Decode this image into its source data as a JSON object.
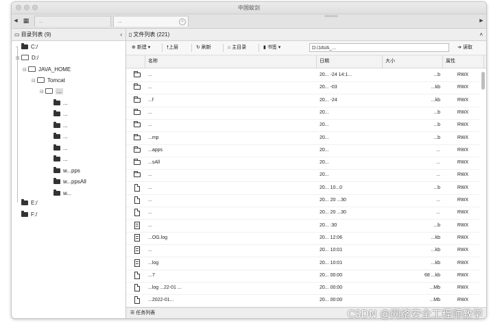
{
  "window": {
    "title": "中国蚁剑"
  },
  "tabs": [
    {
      "label": "..."
    },
    {
      "label": "..."
    }
  ],
  "left_panel": {
    "title": "目录列表 (9)",
    "collapse_glyph": "‹",
    "tree": [
      {
        "label": "C:/"
      },
      {
        "label": "D:/"
      },
      {
        "label": "JAVA_HOME"
      },
      {
        "label": "Tomcat"
      },
      {
        "label": "..."
      },
      {
        "label": "..."
      },
      {
        "label": "..."
      },
      {
        "label": "..."
      },
      {
        "label": "..."
      },
      {
        "label": "..."
      },
      {
        "label": "..."
      },
      {
        "label": "w...pps"
      },
      {
        "label": "w...ppsAll"
      },
      {
        "label": "w..."
      },
      {
        "label": "E:/"
      },
      {
        "label": "F:/"
      }
    ]
  },
  "right_panel": {
    "title": "文件列表 (221)",
    "collapse_glyph": "˄",
    "toolbar": {
      "new": "新建",
      "up": "上层",
      "refresh": "刷新",
      "home": "主目录",
      "bookmark": "书签",
      "path": "D:/JAVA_...",
      "read": "读取"
    },
    "columns": {
      "name": "名称",
      "date": "日期",
      "size": "大小",
      "attr": "属性"
    },
    "files": [
      {
        "type": "folder",
        "name": "...",
        "date": "20... -24 14:1...",
        "size": "...b",
        "attr": "RWX"
      },
      {
        "type": "folder",
        "name": "...",
        "date": "20... -03",
        "size": "...kb",
        "attr": "RWX"
      },
      {
        "type": "folder",
        "name": "...f",
        "date": "20... -24",
        "size": "...kb",
        "attr": "RWX"
      },
      {
        "type": "folder",
        "name": "...",
        "date": "20...",
        "size": "...b",
        "attr": "RWX"
      },
      {
        "type": "folder",
        "name": "...",
        "date": "20...",
        "size": "...b",
        "attr": "RWX"
      },
      {
        "type": "folder",
        "name": "...mp",
        "date": "20...",
        "size": "...b",
        "attr": "RWX"
      },
      {
        "type": "folder",
        "name": "...apps",
        "date": "20...",
        "size": "...",
        "attr": "RWX"
      },
      {
        "type": "folder",
        "name": "...sAll",
        "date": "20...",
        "size": "...",
        "attr": "RWX"
      },
      {
        "type": "folder",
        "name": "...",
        "date": "20...",
        "size": "...",
        "attr": "RWX"
      },
      {
        "type": "file",
        "name": "...",
        "date": "20... 10...0",
        "size": "...b",
        "attr": "RWX"
      },
      {
        "type": "file",
        "name": "...",
        "date": "20... 20 ...30",
        "size": "...",
        "attr": "RWX"
      },
      {
        "type": "file",
        "name": "...",
        "date": "20... 20 ...30",
        "size": "...",
        "attr": "RWX"
      },
      {
        "type": "text",
        "name": "...",
        "date": "20... :30",
        "size": "...b",
        "attr": "RWX"
      },
      {
        "type": "text",
        "name": "...OG.log",
        "date": "20... 12:06",
        "size": "...kb",
        "attr": "RWX"
      },
      {
        "type": "text",
        "name": "...",
        "date": "20... 10:01",
        "size": "...kb",
        "attr": "RWX"
      },
      {
        "type": "text",
        "name": "...log",
        "date": "20... 10:01",
        "size": "...kb",
        "attr": "RWX"
      },
      {
        "type": "file",
        "name": "...7",
        "date": "20... 00:00",
        "size": "68 ...kb",
        "attr": "RWX"
      },
      {
        "type": "file",
        "name": "...log ...22-01 ...",
        "date": "20... 00:00",
        "size": "...Mb",
        "attr": "RWX"
      },
      {
        "type": "file",
        "name": "...2022-01...",
        "date": "20... 00:00",
        "size": "...Mb",
        "attr": "RWX"
      }
    ],
    "status": "任务列表"
  },
  "watermark": "CSDN @网络安全工程师教学"
}
